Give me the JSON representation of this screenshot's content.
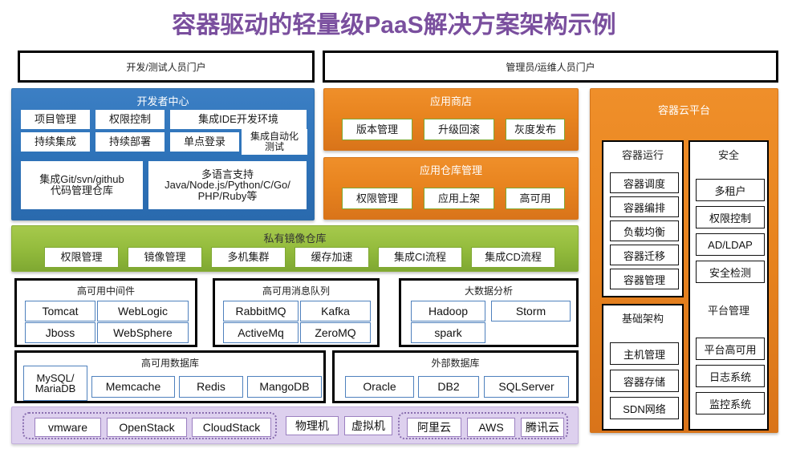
{
  "title": "容器驱动的轻量级PaaS解决方案架构示例",
  "colors": {
    "title": "#7a4f9e",
    "blue": "#2f74ba",
    "orange": "#e8841f",
    "green": "#94bc3d",
    "purple": "#ddd0ee",
    "chip_border_green": "#7fa832",
    "chip_border_blue": "#4f81bd",
    "chip_border_purple": "#9b7fc0"
  },
  "portals": [
    {
      "label": "开发/测试人员门户"
    },
    {
      "label": "管理员/运维人员门户"
    }
  ],
  "developer_center": {
    "title": "开发者中心",
    "row1": [
      "项目管理",
      "权限控制",
      "集成IDE开发环境"
    ],
    "row2": [
      "持续集成",
      "持续部署",
      "单点登录",
      "集成自动化\n测试"
    ],
    "row3": [
      "集成Git/svn/github\n代码管理仓库",
      "多语言支持\nJava/Node.js/Python/C/Go/\nPHP/Ruby等"
    ]
  },
  "app_store": {
    "title": "应用商店",
    "items": [
      "版本管理",
      "升级回滚",
      "灰度发布"
    ]
  },
  "app_repo": {
    "title": "应用仓库管理",
    "items": [
      "权限管理",
      "应用上架",
      "高可用"
    ]
  },
  "private_registry": {
    "title": "私有镜像仓库",
    "items": [
      "权限管理",
      "镜像管理",
      "多机集群",
      "缓存加速",
      "集成CI流程",
      "集成CD流程"
    ]
  },
  "middleware": {
    "title": "高可用中间件",
    "items": [
      "Tomcat",
      "WebLogic",
      "Jboss",
      "WebSphere"
    ]
  },
  "message_queue": {
    "title": "高可用消息队列",
    "items": [
      "RabbitMQ",
      "Kafka",
      "ActiveMq",
      "ZeroMQ"
    ]
  },
  "big_data": {
    "title": "大数据分析",
    "items": [
      "Hadoop",
      "Storm",
      "spark"
    ]
  },
  "ha_database": {
    "title": "高可用数据库",
    "items": [
      "MySQL/\nMariaDB",
      "Memcache",
      "Redis",
      "MangoDB"
    ]
  },
  "external_database": {
    "title": "外部数据库",
    "items": [
      "Oracle",
      "DB2",
      "SQLServer"
    ]
  },
  "infrastructure_band": {
    "group1": [
      "vmware",
      "OpenStack",
      "CloudStack"
    ],
    "group2": [
      "物理机",
      "虚拟机"
    ],
    "group3": [
      "阿里云",
      "AWS",
      "腾讯云"
    ]
  },
  "container_cloud": {
    "title": "容器云平台",
    "panels": [
      {
        "title": "容器运行",
        "items": [
          "容器调度",
          "容器编排",
          "负载均衡",
          "容器迁移",
          "容器管理"
        ]
      },
      {
        "title": "安全",
        "items": [
          "多租户",
          "权限控制",
          "AD/LDAP",
          "安全检测"
        ]
      },
      {
        "title": "基础架构",
        "items": [
          "主机管理",
          "容器存储",
          "SDN网络"
        ]
      },
      {
        "title": "平台管理",
        "items": [
          "平台高可用",
          "日志系统",
          "监控系统"
        ]
      }
    ]
  }
}
